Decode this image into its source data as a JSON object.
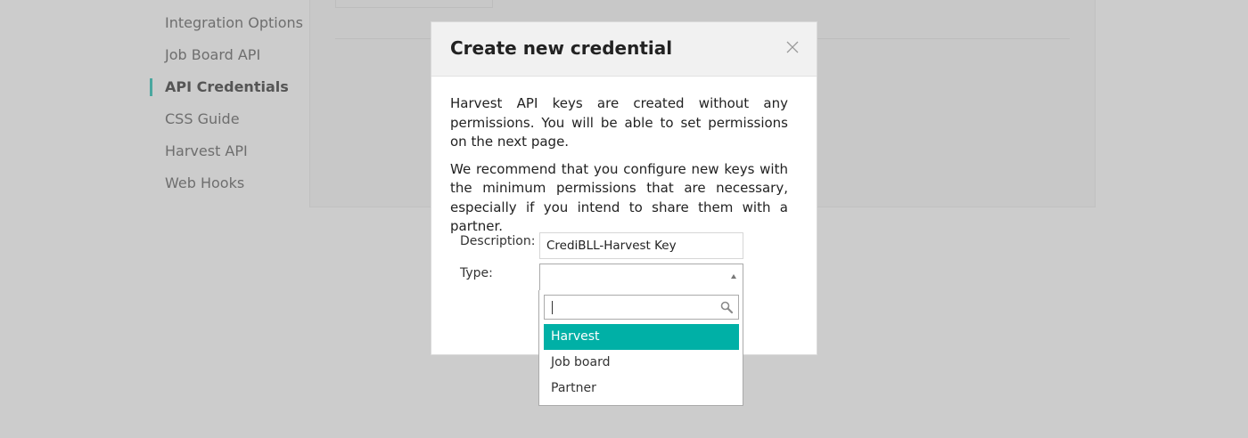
{
  "sidebar": {
    "items": [
      {
        "label": "Integration Options"
      },
      {
        "label": "Job Board API"
      },
      {
        "label": "API Credentials"
      },
      {
        "label": "CSS Guide"
      },
      {
        "label": "Harvest API"
      },
      {
        "label": "Web Hooks"
      }
    ],
    "active_item": "API Credentials",
    "accent_color": "#4aa79f"
  },
  "modal": {
    "title": "Create new credential",
    "close_icon": "close-icon",
    "paragraphs": [
      "Harvest API keys are created without any permissions. You will be able to set permissions on the next page.",
      "We recommend that you configure new keys with the minimum permissions that are necessary, especially if you intend to share them with a partner."
    ],
    "description": {
      "label": "Description:",
      "value": "CrediBLL-Harvest Key"
    },
    "type": {
      "label": "Type:",
      "selected": "",
      "dropdown_open": true
    }
  },
  "dropdown": {
    "search_value": "",
    "search_icon": "search-icon",
    "options": [
      {
        "label": "Harvest"
      },
      {
        "label": "Job board"
      },
      {
        "label": "Partner"
      }
    ],
    "highlighted": "Harvest",
    "highlight_color": "#00b0a6"
  }
}
